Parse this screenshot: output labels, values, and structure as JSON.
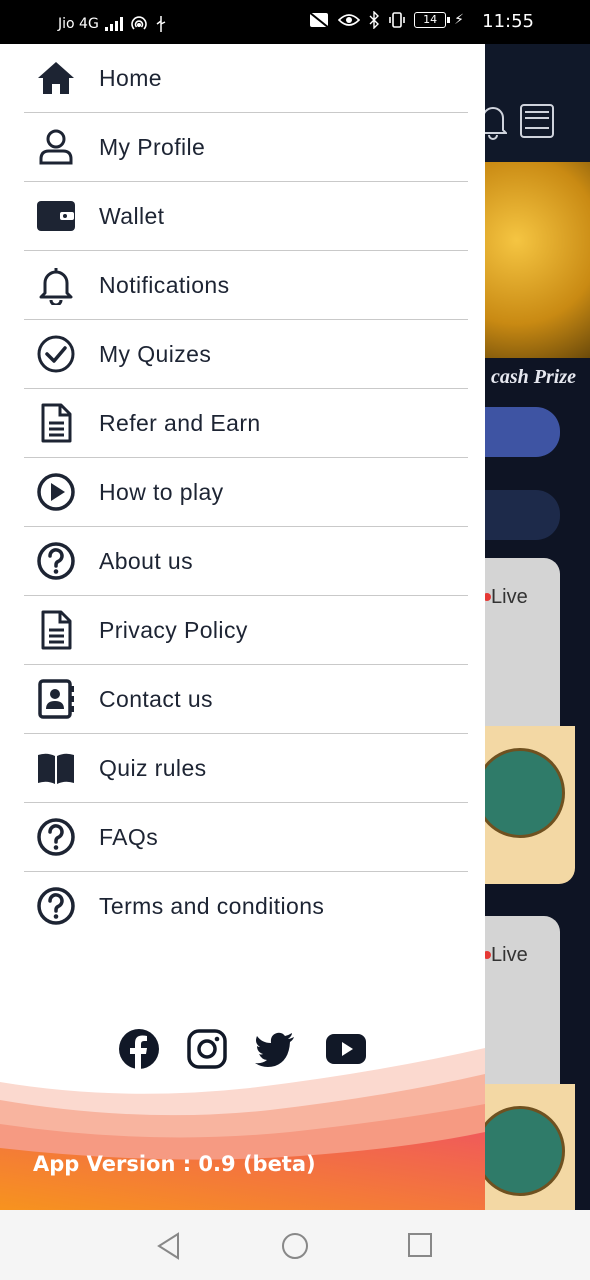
{
  "status_bar": {
    "carrier": "Jio 4G",
    "net_tag": "4G",
    "battery": "14",
    "time": "11:55"
  },
  "background": {
    "banner_text": "cash Prize",
    "cards": [
      {
        "badge": "Live"
      },
      {
        "badge": "Live"
      }
    ]
  },
  "menu": {
    "items": [
      {
        "label": "Home",
        "icon": "home-icon"
      },
      {
        "label": "My Profile",
        "icon": "user-icon"
      },
      {
        "label": "Wallet",
        "icon": "wallet-icon"
      },
      {
        "label": "Notifications",
        "icon": "bell-icon"
      },
      {
        "label": "My Quizes",
        "icon": "check-circle-icon"
      },
      {
        "label": "Refer and Earn",
        "icon": "document-icon"
      },
      {
        "label": "How to play",
        "icon": "play-circle-icon"
      },
      {
        "label": "About us",
        "icon": "question-circle-icon"
      },
      {
        "label": "Privacy Policy",
        "icon": "document-icon"
      },
      {
        "label": "Contact us",
        "icon": "address-book-icon"
      },
      {
        "label": "Quiz rules",
        "icon": "book-icon"
      },
      {
        "label": "FAQs",
        "icon": "question-circle-icon"
      },
      {
        "label": "Terms and conditions",
        "icon": "question-circle-icon"
      }
    ]
  },
  "social": [
    "facebook-icon",
    "instagram-icon",
    "twitter-icon",
    "youtube-icon"
  ],
  "footer": {
    "version": "App Version : 0.9 (beta)"
  },
  "colors": {
    "text": "#1d2433",
    "drawer_bg": "#ffffff",
    "wave_orange": "#f7931e",
    "wave_pink": "#f05a5a"
  }
}
